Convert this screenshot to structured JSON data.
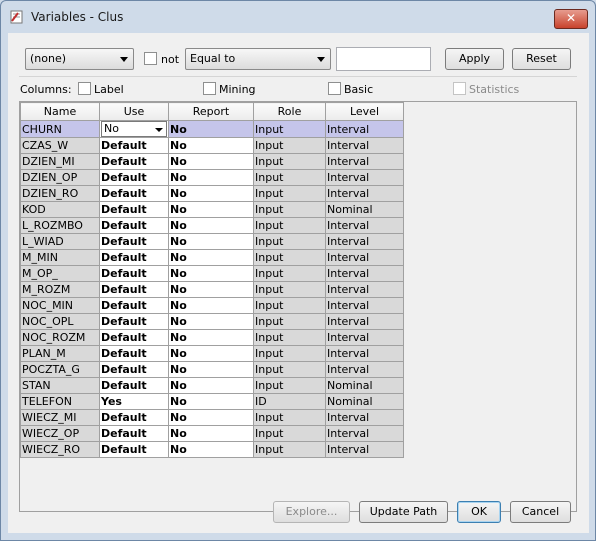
{
  "window": {
    "title": "Variables - Clus",
    "close_label": "✕"
  },
  "filter": {
    "column_select": "(none)",
    "not_label": "not",
    "operator_select": "Equal to",
    "value": "",
    "apply_label": "Apply",
    "reset_label": "Reset"
  },
  "columns_bar": {
    "title": "Columns:",
    "label_opt": "Label",
    "mining_opt": "Mining",
    "basic_opt": "Basic",
    "statistics_opt": "Statistics"
  },
  "table": {
    "headers": [
      "Name",
      "Use",
      "Report",
      "Role",
      "Level"
    ],
    "rows": [
      {
        "name": "CHURN",
        "use": "No",
        "report": "No",
        "role": "Input",
        "level": "Interval"
      },
      {
        "name": "CZAS_W",
        "use": "Default",
        "report": "No",
        "role": "Input",
        "level": "Interval"
      },
      {
        "name": "DZIEN_MI",
        "use": "Default",
        "report": "No",
        "role": "Input",
        "level": "Interval"
      },
      {
        "name": "DZIEN_OP",
        "use": "Default",
        "report": "No",
        "role": "Input",
        "level": "Interval"
      },
      {
        "name": "DZIEN_RO",
        "use": "Default",
        "report": "No",
        "role": "Input",
        "level": "Interval"
      },
      {
        "name": "KOD",
        "use": "Default",
        "report": "No",
        "role": "Input",
        "level": "Nominal"
      },
      {
        "name": "L_ROZMBO",
        "use": "Default",
        "report": "No",
        "role": "Input",
        "level": "Interval"
      },
      {
        "name": "L_WIAD",
        "use": "Default",
        "report": "No",
        "role": "Input",
        "level": "Interval"
      },
      {
        "name": "M_MIN",
        "use": "Default",
        "report": "No",
        "role": "Input",
        "level": "Interval"
      },
      {
        "name": "M_OP_",
        "use": "Default",
        "report": "No",
        "role": "Input",
        "level": "Interval"
      },
      {
        "name": "M_ROZM",
        "use": "Default",
        "report": "No",
        "role": "Input",
        "level": "Interval"
      },
      {
        "name": "NOC_MIN",
        "use": "Default",
        "report": "No",
        "role": "Input",
        "level": "Interval"
      },
      {
        "name": "NOC_OPL",
        "use": "Default",
        "report": "No",
        "role": "Input",
        "level": "Interval"
      },
      {
        "name": "NOC_ROZM",
        "use": "Default",
        "report": "No",
        "role": "Input",
        "level": "Interval"
      },
      {
        "name": "PLAN_M",
        "use": "Default",
        "report": "No",
        "role": "Input",
        "level": "Interval"
      },
      {
        "name": "POCZTA_G",
        "use": "Default",
        "report": "No",
        "role": "Input",
        "level": "Interval"
      },
      {
        "name": "STAN",
        "use": "Default",
        "report": "No",
        "role": "Input",
        "level": "Nominal"
      },
      {
        "name": "TELEFON",
        "use": "Yes",
        "report": "No",
        "role": "ID",
        "level": "Nominal"
      },
      {
        "name": "WIECZ_MI",
        "use": "Default",
        "report": "No",
        "role": "Input",
        "level": "Interval"
      },
      {
        "name": "WIECZ_OP",
        "use": "Default",
        "report": "No",
        "role": "Input",
        "level": "Interval"
      },
      {
        "name": "WIECZ_RO",
        "use": "Default",
        "report": "No",
        "role": "Input",
        "level": "Interval"
      }
    ]
  },
  "footer": {
    "explore_label": "Explore...",
    "update_path_label": "Update Path",
    "ok_label": "OK",
    "cancel_label": "Cancel"
  }
}
